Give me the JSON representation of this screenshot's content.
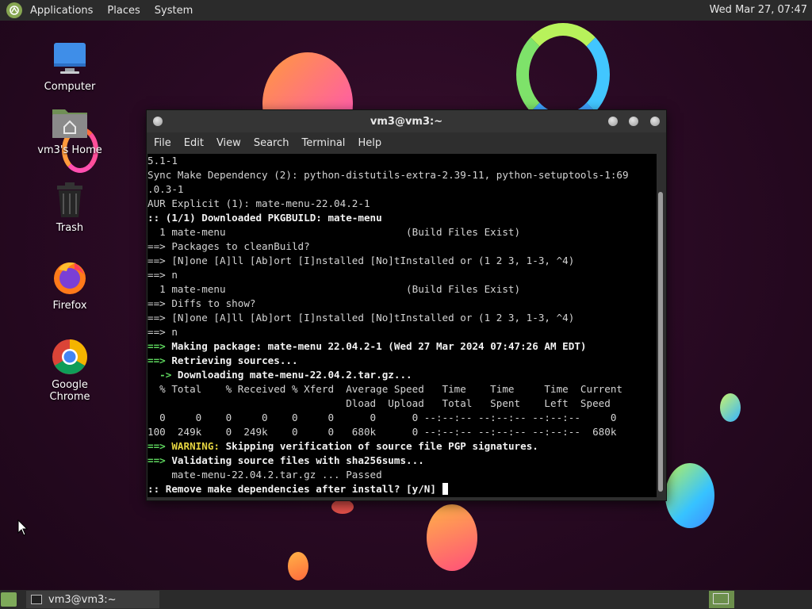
{
  "top_panel": {
    "menu": [
      "Applications",
      "Places",
      "System"
    ],
    "clock": "Wed Mar 27, 07:47"
  },
  "desktop_icons": [
    {
      "label": "Computer",
      "icon": "computer-icon"
    },
    {
      "label": "vm3's Home",
      "icon": "home-folder-icon"
    },
    {
      "label": "Trash",
      "icon": "trash-icon"
    },
    {
      "label": "Firefox",
      "icon": "firefox-icon"
    },
    {
      "label": "Google Chrome",
      "icon": "chrome-icon"
    }
  ],
  "terminal": {
    "title": "vm3@vm3:~",
    "menu": [
      "File",
      "Edit",
      "View",
      "Search",
      "Terminal",
      "Help"
    ],
    "lines": [
      [
        {
          "t": "5.1-1",
          "s": ""
        }
      ],
      [
        {
          "t": "Sync Make Dependency (2): python-distutils-extra-2.39-11, python-setuptools-1:69",
          "s": ""
        }
      ],
      [
        {
          "t": ".0.3-1",
          "s": ""
        }
      ],
      [
        {
          "t": "AUR Explicit (1): mate-menu-22.04.2-1",
          "s": ""
        }
      ],
      [
        {
          "t": ":: (1/1) Downloaded PKGBUILD: mate-menu",
          "s": "b"
        }
      ],
      [
        {
          "t": "  1 mate-menu                              (Build Files Exist)",
          "s": ""
        }
      ],
      [
        {
          "t": "==> Packages to cleanBuild?",
          "s": ""
        }
      ],
      [
        {
          "t": "==> [N]one [A]ll [Ab]ort [I]nstalled [No]tInstalled or (1 2 3, 1-3, ^4)",
          "s": ""
        }
      ],
      [
        {
          "t": "==> n",
          "s": ""
        }
      ],
      [
        {
          "t": "  1 mate-menu                              (Build Files Exist)",
          "s": ""
        }
      ],
      [
        {
          "t": "==> Diffs to show?",
          "s": ""
        }
      ],
      [
        {
          "t": "==> [N]one [A]ll [Ab]ort [I]nstalled [No]tInstalled or (1 2 3, 1-3, ^4)",
          "s": ""
        }
      ],
      [
        {
          "t": "==> n",
          "s": ""
        }
      ],
      [
        {
          "t": "==> ",
          "s": "g"
        },
        {
          "t": "Making package: mate-menu 22.04.2-1 (Wed 27 Mar 2024 07:47:26 AM EDT)",
          "s": "b"
        }
      ],
      [
        {
          "t": "==> ",
          "s": "g"
        },
        {
          "t": "Retrieving sources...",
          "s": "b"
        }
      ],
      [
        {
          "t": "  -> ",
          "s": "g"
        },
        {
          "t": "Downloading mate-menu-22.04.2.tar.gz...",
          "s": "b"
        }
      ],
      [
        {
          "t": "  % Total    % Received % Xferd  Average Speed   Time    Time     Time  Current",
          "s": ""
        }
      ],
      [
        {
          "t": "                                 Dload  Upload   Total   Spent    Left  Speed",
          "s": ""
        }
      ],
      [
        {
          "t": "  0     0    0     0    0     0      0      0 --:--:-- --:--:-- --:--:--     0",
          "s": ""
        }
      ],
      [
        {
          "t": "100  249k    0  249k    0     0   680k      0 --:--:-- --:--:-- --:--:--  680k",
          "s": ""
        }
      ],
      [
        {
          "t": "==> ",
          "s": "g"
        },
        {
          "t": "WARNING: ",
          "s": "y"
        },
        {
          "t": "Skipping verification of source file PGP signatures.",
          "s": "b"
        }
      ],
      [
        {
          "t": "==> ",
          "s": "g"
        },
        {
          "t": "Validating source files with sha256sums...",
          "s": "b"
        }
      ],
      [
        {
          "t": "    mate-menu-22.04.2.tar.gz ... Passed",
          "s": ""
        }
      ],
      [
        {
          "t": ":: Remove make dependencies after install? [y/N] ",
          "s": "b"
        }
      ]
    ]
  },
  "bottom_panel": {
    "task": "vm3@vm3:~"
  }
}
